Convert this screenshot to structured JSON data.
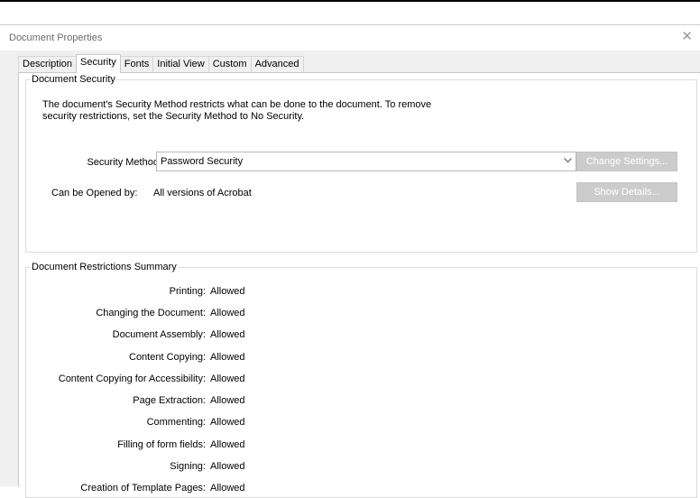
{
  "window": {
    "title": "Document Properties",
    "close_glyph": "✕"
  },
  "tabs": [
    {
      "label": "Description",
      "active": false
    },
    {
      "label": "Security",
      "active": true
    },
    {
      "label": "Fonts",
      "active": false
    },
    {
      "label": "Initial View",
      "active": false
    },
    {
      "label": "Custom",
      "active": false
    },
    {
      "label": "Advanced",
      "active": false
    }
  ],
  "security": {
    "legend": "Document Security",
    "description_line1": "The document's Security Method restricts what can be done to the document. To remove",
    "description_line2": "security restrictions, set the Security Method to No Security.",
    "method_label": "Security Method:",
    "method_value": "Password Security",
    "change_settings_label": "Change Settings...",
    "opened_by_label": "Can be Opened by:",
    "opened_by_value": "All versions of Acrobat",
    "show_details_label": "Show Details..."
  },
  "restrictions": {
    "legend": "Document Restrictions Summary",
    "rows": [
      {
        "label": "Printing:",
        "value": "Allowed"
      },
      {
        "label": "Changing the Document:",
        "value": "Allowed"
      },
      {
        "label": "Document Assembly:",
        "value": "Allowed"
      },
      {
        "label": "Content Copying:",
        "value": "Allowed"
      },
      {
        "label": "Content Copying for Accessibility:",
        "value": "Allowed"
      },
      {
        "label": "Page Extraction:",
        "value": "Allowed"
      },
      {
        "label": "Commenting:",
        "value": "Allowed"
      },
      {
        "label": "Filling of form fields:",
        "value": "Allowed"
      },
      {
        "label": "Signing:",
        "value": "Allowed"
      },
      {
        "label": "Creation of Template Pages:",
        "value": "Allowed"
      }
    ]
  }
}
